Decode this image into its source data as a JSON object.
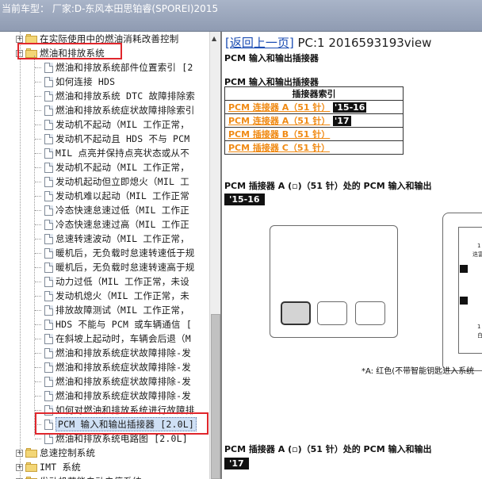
{
  "window": {
    "title": "当前车型：  厂家:D-东风本田思铂睿(SPOREI)2015"
  },
  "tree": {
    "items": [
      {
        "label": "在实际使用中的燃油消耗改善控制",
        "type": "folder",
        "expander": "+"
      },
      {
        "label": "燃油和排放系统",
        "type": "folder",
        "expander": "−"
      },
      {
        "label": "燃油和排放系统部件位置索引 [2",
        "type": "doc"
      },
      {
        "label": "如何连接 HDS",
        "type": "doc"
      },
      {
        "label": "燃油和排放系统 DTC 故障排除索",
        "type": "doc"
      },
      {
        "label": "燃油和排放系统症状故障排除索引",
        "type": "doc"
      },
      {
        "label": "发动机不起动（MIL 工作正常，",
        "type": "doc"
      },
      {
        "label": "发动机不起动且 HDS 不与 PCM",
        "type": "doc"
      },
      {
        "label": "MIL 点亮并保持点亮状态或从不",
        "type": "doc"
      },
      {
        "label": "发动机不起动（MIL 工作正常，",
        "type": "doc"
      },
      {
        "label": "发动机起动但立即熄火（MIL 工",
        "type": "doc"
      },
      {
        "label": "发动机难以起动（MIL 工作正常",
        "type": "doc"
      },
      {
        "label": "冷态快速怠速过低（MIL 工作正",
        "type": "doc"
      },
      {
        "label": "冷态快速怠速过高（MIL 工作正",
        "type": "doc"
      },
      {
        "label": "怠速转速波动（MIL 工作正常，",
        "type": "doc"
      },
      {
        "label": "暖机后，无负载时怠速转速低于规",
        "type": "doc"
      },
      {
        "label": "暖机后，无负载时怠速转速高于规",
        "type": "doc"
      },
      {
        "label": "动力过低（MIL 工作正常，未设",
        "type": "doc"
      },
      {
        "label": "发动机熄火（MIL 工作正常，未",
        "type": "doc"
      },
      {
        "label": "排放故障测试（MIL 工作正常，",
        "type": "doc"
      },
      {
        "label": "HDS 不能与 PCM 或车辆通信 [",
        "type": "doc"
      },
      {
        "label": "在斜坡上起动时，车辆会后退（M",
        "type": "doc"
      },
      {
        "label": "燃油和排放系统症状故障排除-发",
        "type": "doc"
      },
      {
        "label": "燃油和排放系统症状故障排除-发",
        "type": "doc"
      },
      {
        "label": "燃油和排放系统症状故障排除-发",
        "type": "doc"
      },
      {
        "label": "燃油和排放系统症状故障排除-发",
        "type": "doc"
      },
      {
        "label": "如何对燃油和排放系统进行故障排",
        "type": "doc"
      },
      {
        "label": "PCM 输入和输出插接器 [2.0L]",
        "type": "doc",
        "selected": true
      },
      {
        "label": "燃油和排放系统电路图 [2.0L]",
        "type": "doc"
      },
      {
        "label": "怠速控制系统",
        "type": "folder",
        "expander": "+"
      },
      {
        "label": "IMT 系统",
        "type": "folder",
        "expander": "+"
      },
      {
        "label": "发动机节能自动启停系统",
        "type": "folder",
        "expander": "+"
      }
    ]
  },
  "content": {
    "back_link": "[返回上一页]",
    "page_id": " PC:1 2016593193view",
    "heading1": "PCM 输入和输出插接器",
    "heading2": "PCM 输入和输出插接器",
    "table_header": "插接器索引",
    "rows": [
      {
        "link": "PCM 连接器 A（51 针）",
        "tag": "'15-16"
      },
      {
        "link": "PCM 连接器 A（51 针）",
        "tag": "'17"
      },
      {
        "link": "PCM 插接器 B（51 针）",
        "tag": ""
      },
      {
        "link": "PCM 插接器 C（51 针）",
        "tag": ""
      }
    ],
    "section1_title": "PCM 插接器 A (▫)（51 针）处的 PCM 输入和输出",
    "section1_tag": "'15-16",
    "note": "*A: 红色(不带智能钥匙进入系统",
    "section2_title": "PCM 插接器 A (▫)（51 针）处的 PCM 输入和输出",
    "section2_tag": "'17",
    "side_labels": [
      "1",
      "迭富",
      "1",
      "白"
    ]
  },
  "colors": {
    "highlight_border": "#e0262c",
    "link_orange": "#f08a14",
    "back_link_blue": "#1b4db3"
  }
}
